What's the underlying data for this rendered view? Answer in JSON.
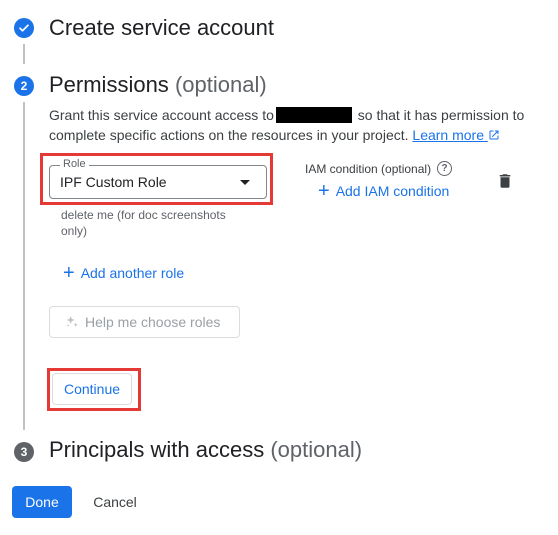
{
  "steps": [
    {
      "number": "",
      "title": "Create service account",
      "optional": "",
      "status": "done"
    },
    {
      "number": "2",
      "title": "Permissions",
      "optional": "(optional)",
      "status": "active"
    },
    {
      "number": "3",
      "title": "Principals with access",
      "optional": "(optional)",
      "status": "pending"
    }
  ],
  "permissions": {
    "description_part1": "Grant this service account access to",
    "description_part2": "so that it has permission to complete specific actions on the resources in your project.",
    "learn_more": "Learn more",
    "role_label": "Role",
    "role_value": "IPF Custom Role",
    "role_hint": "delete me (for doc screenshots only)",
    "iam_condition_label": "IAM condition (optional)",
    "add_iam_condition": "Add IAM condition",
    "add_another_role": "Add another role",
    "help_choose_roles": "Help me choose roles",
    "continue_label": "Continue"
  },
  "footer": {
    "done_label": "Done",
    "cancel_label": "Cancel"
  },
  "icons": {
    "step_done": "check-icon",
    "help": "help-circle-icon",
    "delete": "trash-icon",
    "add": "plus-icon",
    "external": "external-link-icon",
    "sparkle": "sparkle-icon"
  },
  "colors": {
    "accent": "#1a73e8",
    "highlight": "#e53935",
    "pending_badge": "#5f6368"
  }
}
